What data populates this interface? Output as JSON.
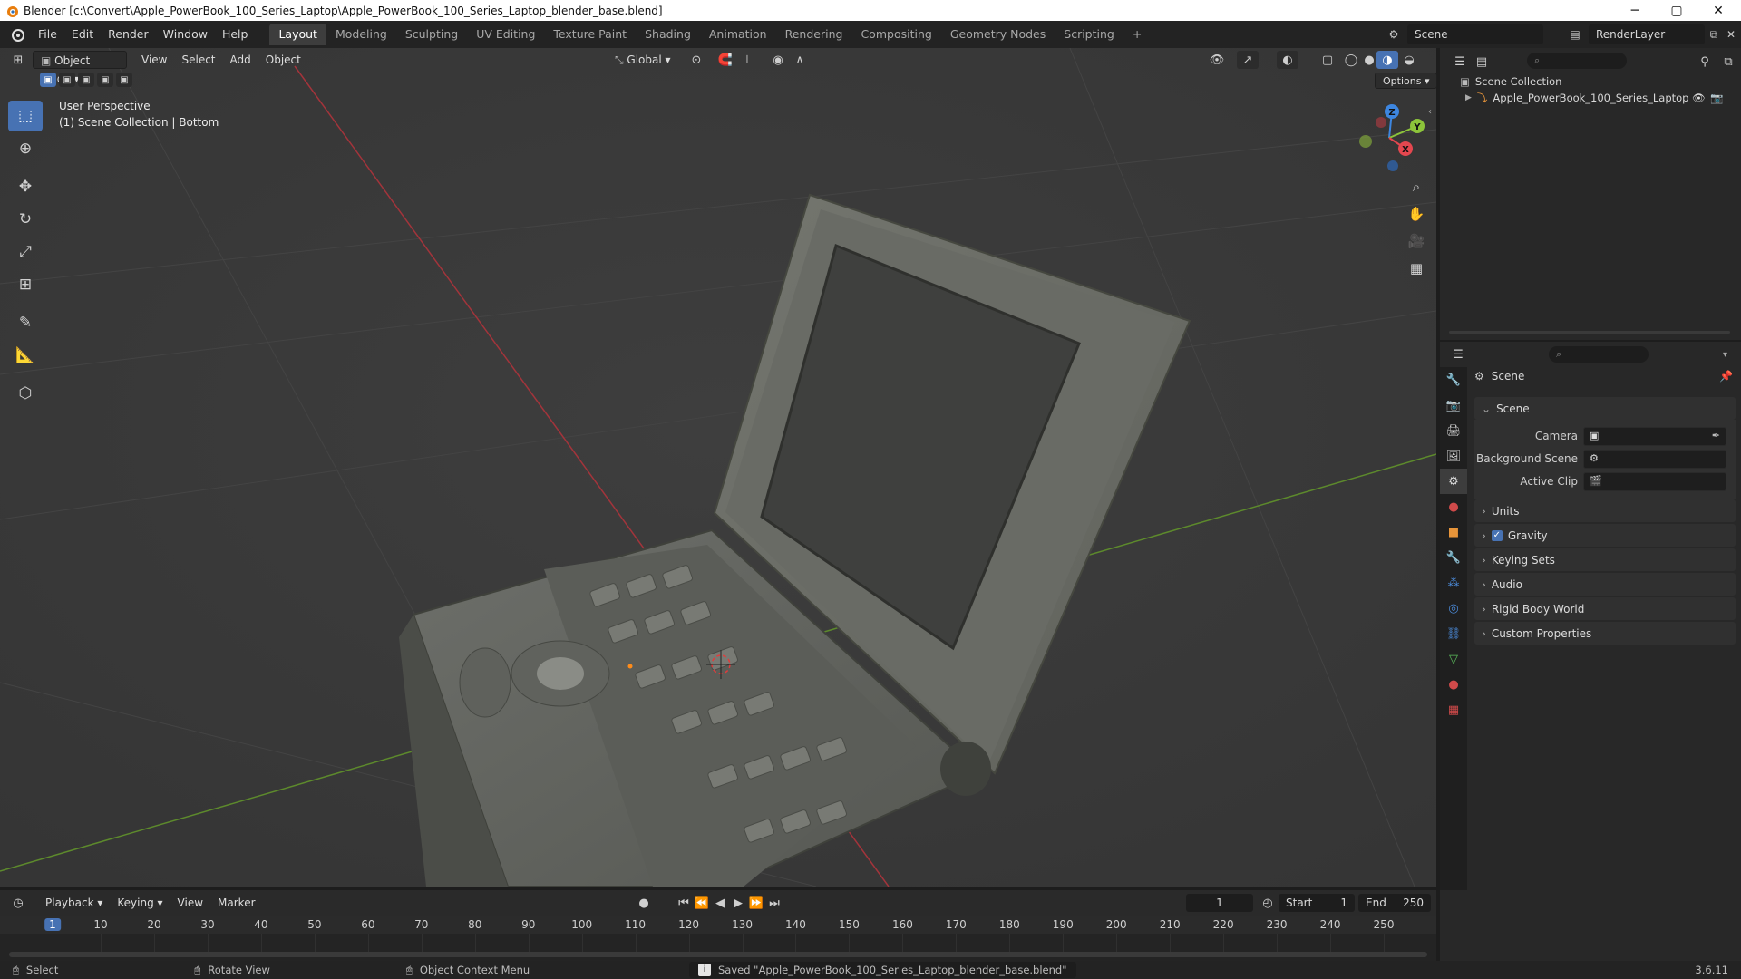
{
  "window": {
    "title": "Blender [c:\\Convert\\Apple_PowerBook_100_Series_Laptop\\Apple_PowerBook_100_Series_Laptop_blender_base.blend]",
    "min": "─",
    "max": "▢",
    "close": "✕"
  },
  "menu": [
    "File",
    "Edit",
    "Render",
    "Window",
    "Help"
  ],
  "workspaces": [
    "Layout",
    "Modeling",
    "Sculpting",
    "UV Editing",
    "Texture Paint",
    "Shading",
    "Animation",
    "Rendering",
    "Compositing",
    "Geometry Nodes",
    "Scripting"
  ],
  "workspace_add": "+",
  "scene_selector": {
    "value": "Scene"
  },
  "renderlayer_selector": {
    "value": "RenderLayer"
  },
  "viewport": {
    "mode": "Object Mode",
    "menus": [
      "View",
      "Select",
      "Add",
      "Object"
    ],
    "orientation": "Global",
    "options": "Options",
    "overlay_line1": "User Perspective",
    "overlay_line2": "(1) Scene Collection | Bottom",
    "gizmo": {
      "z": "Z",
      "y": "Y",
      "x": "X"
    }
  },
  "outliner": {
    "root": "Scene Collection",
    "item": "Apple_PowerBook_100_Series_Laptop"
  },
  "properties": {
    "title": "Scene",
    "section": "Scene",
    "fields": [
      {
        "label": "Camera"
      },
      {
        "label": "Background Scene"
      },
      {
        "label": "Active Clip"
      }
    ],
    "panels": [
      "Units",
      "Gravity",
      "Keying Sets",
      "Audio",
      "Rigid Body World",
      "Custom Properties"
    ],
    "gravity_checked": true
  },
  "timeline": {
    "menus": [
      "Playback",
      "Keying",
      "View",
      "Marker"
    ],
    "current_frame": "1",
    "start_label": "Start",
    "start": "1",
    "end_label": "End",
    "end": "250",
    "ticks": [
      "1",
      "10",
      "20",
      "30",
      "40",
      "50",
      "60",
      "70",
      "80",
      "90",
      "100",
      "110",
      "120",
      "130",
      "140",
      "150",
      "160",
      "170",
      "180",
      "190",
      "200",
      "210",
      "220",
      "230",
      "240",
      "250"
    ]
  },
  "status": {
    "select": "Select",
    "rotate": "Rotate View",
    "context": "Object Context Menu",
    "message": "Saved \"Apple_PowerBook_100_Series_Laptop_blender_base.blend\"",
    "version": "3.6.11"
  },
  "colors": {
    "accent": "#4772b3",
    "x_axis": "#e4474f",
    "y_axis": "#8cc43a",
    "z_axis": "#3d86e0"
  }
}
